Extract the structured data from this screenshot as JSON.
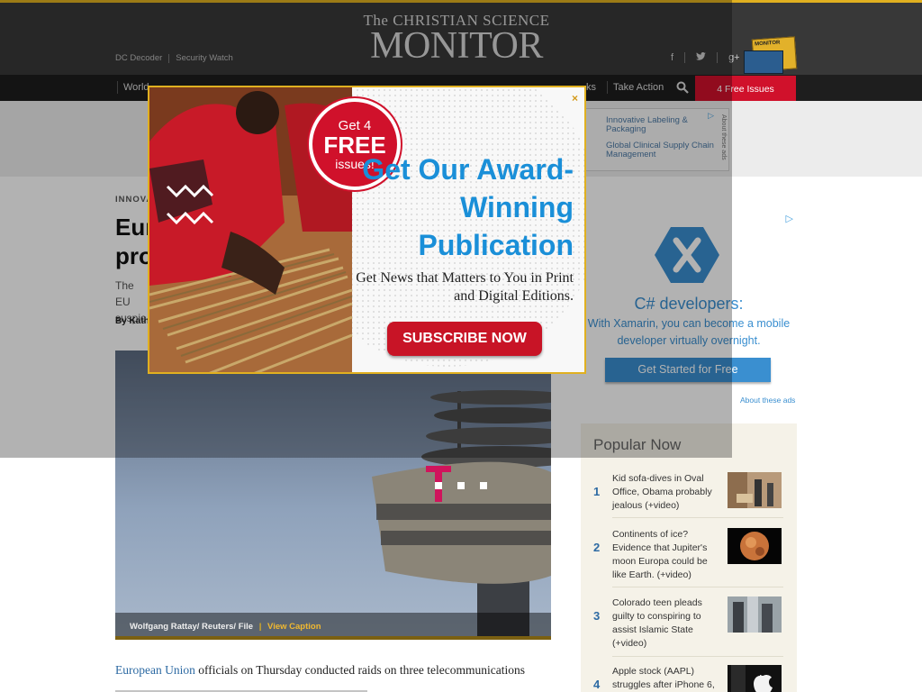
{
  "masthead": {
    "logo_line1": "The CHRISTIAN SCIENCE",
    "logo_line2": "MONITOR",
    "sublinks": [
      "DC Decoder",
      "Security Watch"
    ],
    "social": [
      "f",
      "t",
      "g+"
    ]
  },
  "nav": {
    "items": [
      "World",
      "ks",
      "Take Action"
    ],
    "free_issues": "4 Free Issues"
  },
  "top_ad": {
    "items": [
      "Innovative Labeling & Packaging",
      "Global Clinical Supply Chain Management"
    ],
    "about": "About these ads"
  },
  "article": {
    "eyebrow": "INNOVA",
    "headline_lines": [
      "Eur",
      "pro"
    ],
    "summary_lines": [
      "The EU",
      "suspic"
    ],
    "byline": "By Kath",
    "photo_credit": "Wolfgang Rattay/ Reuters/ File",
    "caption_sep": "|",
    "view_caption": "View Caption",
    "body_link": "European Union",
    "body_text": " officials on Thursday conducted raids on three telecommunications"
  },
  "side_ad": {
    "title": "C# developers:",
    "description": "With Xamarin, you can become a mobile developer virtually overnight.",
    "cta": "Get Started for Free",
    "about": "About these ads"
  },
  "popular_now": {
    "title": "Popular Now",
    "items": [
      {
        "num": "1",
        "text": "Kid sofa-dives in Oval Office, Obama probably jealous (+video)"
      },
      {
        "num": "2",
        "text": "Continents of ice? Evidence that Jupiter's moon Europa could be like Earth. (+video)"
      },
      {
        "num": "3",
        "text": "Colorado teen pleads guilty to conspiring to assist Islamic State (+video)"
      },
      {
        "num": "4",
        "text": "Apple stock (AAPL) struggles after iPhone 6,"
      }
    ]
  },
  "popup": {
    "close": "×",
    "badge_line1": "Get 4",
    "badge_line2": "FREE",
    "badge_line3": "issues!",
    "headline": "Get Our Award-Winning Publication",
    "subtext": "Get News that Matters to You in Print and Digital Editions.",
    "subscribe": "SUBSCRIBE NOW"
  },
  "colors": {
    "accent_gold": "#e0b020",
    "brand_red": "#d0112b",
    "popup_blue": "#1a8fd8",
    "link_blue": "#2d6aa3"
  }
}
